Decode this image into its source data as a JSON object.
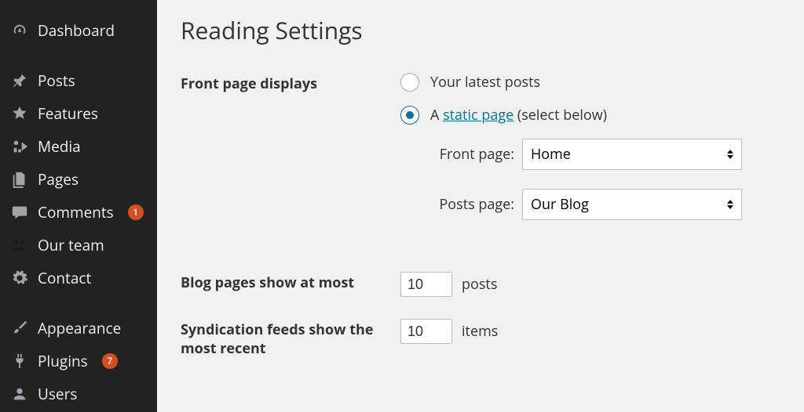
{
  "sidebar": {
    "items": [
      {
        "label": "Dashboard",
        "icon": "dashboard-icon",
        "interactable": true
      },
      {
        "label": "Posts",
        "icon": "pin-icon",
        "interactable": true
      },
      {
        "label": "Features",
        "icon": "star-icon",
        "interactable": true
      },
      {
        "label": "Media",
        "icon": "media-icon",
        "interactable": true
      },
      {
        "label": "Pages",
        "icon": "pages-icon",
        "interactable": true
      },
      {
        "label": "Comments",
        "icon": "comment-icon",
        "interactable": true,
        "badge": "1"
      },
      {
        "label": "Our team",
        "icon": "team-icon",
        "interactable": true
      },
      {
        "label": "Contact",
        "icon": "gear-icon",
        "interactable": true
      },
      {
        "label": "Appearance",
        "icon": "brush-icon",
        "interactable": true
      },
      {
        "label": "Plugins",
        "icon": "plug-icon",
        "interactable": true,
        "badge": "7"
      },
      {
        "label": "Users",
        "icon": "user-icon",
        "interactable": true
      }
    ]
  },
  "page": {
    "title": "Reading Settings"
  },
  "front_page": {
    "section_label": "Front page displays",
    "option_latest": "Your latest posts",
    "option_static_prefix": "A ",
    "option_static_link": "static page",
    "option_static_suffix": " (select below)",
    "selected": "static",
    "front_label": "Front page:",
    "front_value": "Home",
    "posts_label": "Posts page:",
    "posts_value": "Our Blog"
  },
  "blog_pages": {
    "label": "Blog pages show at most",
    "value": "10",
    "unit": "posts"
  },
  "feeds": {
    "label": "Syndication feeds show the most recent",
    "value": "10",
    "unit": "items"
  }
}
